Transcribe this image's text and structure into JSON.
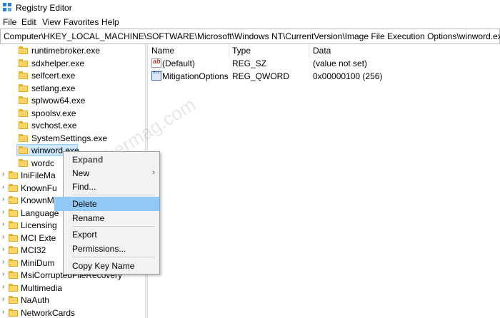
{
  "window": {
    "title": "Registry Editor"
  },
  "menu": [
    "File",
    "Edit",
    "View",
    "Favorites",
    "Help"
  ],
  "address": "Computer\\HKEY_LOCAL_MACHINE\\SOFTWARE\\Microsoft\\Windows NT\\CurrentVersion\\Image File Execution Options\\winword.exe",
  "tree": {
    "subkeys": [
      "runtimebroker.exe",
      "sdxhelper.exe",
      "selfcert.exe",
      "setlang.exe",
      "splwow64.exe",
      "spoolsv.exe",
      "svchost.exe",
      "SystemSettings.exe",
      "winword.exe",
      "wordc"
    ],
    "keys": [
      "IniFileMa",
      "KnownFu",
      "KnownM",
      "Language",
      "Licensing",
      "MCI Exte",
      "MCI32",
      "MiniDum",
      "MsiCorruptedFileRecovery",
      "Multimedia",
      "NaAuth",
      "NetworkCards"
    ]
  },
  "values_pane": {
    "columns": [
      "Name",
      "Type",
      "Data"
    ],
    "rows": [
      {
        "name": "(Default)",
        "type": "REG_SZ",
        "data": "(value not set)",
        "icon": "string-value-icon"
      },
      {
        "name": "MitigationOptions",
        "type": "REG_QWORD",
        "data": "0x00000100 (256)",
        "icon": "binary-value-icon"
      }
    ]
  },
  "context_menu": {
    "items": [
      "Expand",
      "New",
      "Find...",
      "Delete",
      "Rename",
      "Export",
      "Permissions...",
      "Copy Key Name"
    ],
    "highlighted": "Delete"
  },
  "watermark": "geekermag.com"
}
